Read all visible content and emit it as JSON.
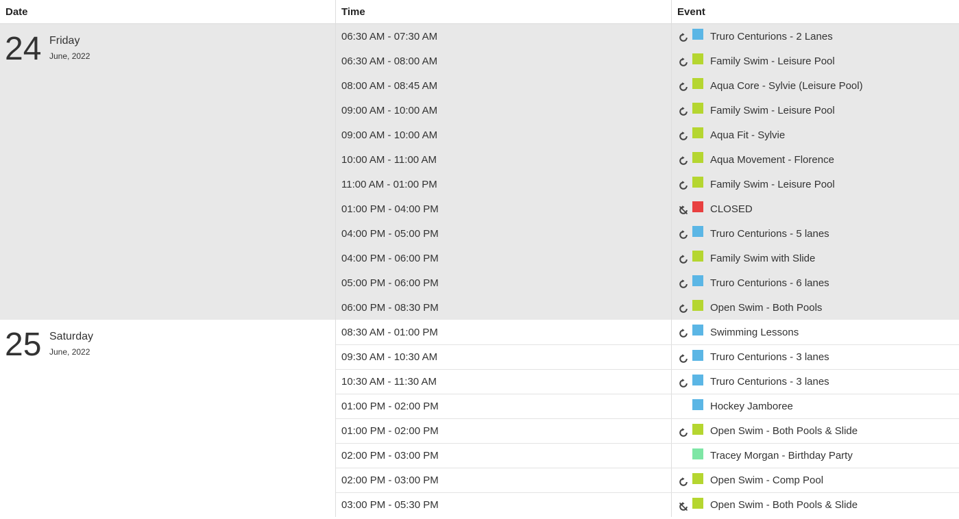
{
  "header": {
    "date": "Date",
    "time": "Time",
    "event": "Event"
  },
  "colors": {
    "blue": "#5bb6e5",
    "green": "#b5d630",
    "red": "#e84040",
    "mint": "#7ee6a5"
  },
  "days": [
    {
      "number": "24",
      "weekday": "Friday",
      "month": "June, 2022",
      "events": [
        {
          "time": "06:30 AM - 07:30 AM",
          "title": "Truro Centurions - 2 Lanes",
          "color": "#5bb6e5",
          "icon": "recurring-icon"
        },
        {
          "time": "06:30 AM - 08:00 AM",
          "title": "Family Swim - Leisure Pool",
          "color": "#b5d630",
          "icon": "recurring-icon"
        },
        {
          "time": "08:00 AM - 08:45 AM",
          "title": "Aqua Core - Sylvie (Leisure Pool)",
          "color": "#b5d630",
          "icon": "recurring-icon"
        },
        {
          "time": "09:00 AM - 10:00 AM",
          "title": "Family Swim - Leisure Pool",
          "color": "#b5d630",
          "icon": "recurring-icon"
        },
        {
          "time": "09:00 AM - 10:00 AM",
          "title": "Aqua Fit - Sylvie",
          "color": "#b5d630",
          "icon": "recurring-icon"
        },
        {
          "time": "10:00 AM - 11:00 AM",
          "title": "Aqua Movement - Florence",
          "color": "#b5d630",
          "icon": "recurring-icon"
        },
        {
          "time": "11:00 AM - 01:00 PM",
          "title": "Family Swim - Leisure Pool",
          "color": "#b5d630",
          "icon": "recurring-icon"
        },
        {
          "time": "01:00 PM - 04:00 PM",
          "title": "CLOSED",
          "color": "#e84040",
          "icon": "recurring-off-icon"
        },
        {
          "time": "04:00 PM - 05:00 PM",
          "title": "Truro Centurions - 5 lanes",
          "color": "#5bb6e5",
          "icon": "recurring-icon"
        },
        {
          "time": "04:00 PM - 06:00 PM",
          "title": "Family Swim with Slide",
          "color": "#b5d630",
          "icon": "recurring-icon"
        },
        {
          "time": "05:00 PM - 06:00 PM",
          "title": "Truro Centurions - 6 lanes",
          "color": "#5bb6e5",
          "icon": "recurring-icon"
        },
        {
          "time": "06:00 PM - 08:30 PM",
          "title": "Open Swim - Both Pools",
          "color": "#b5d630",
          "icon": "recurring-icon"
        }
      ]
    },
    {
      "number": "25",
      "weekday": "Saturday",
      "month": "June, 2022",
      "events": [
        {
          "time": "08:30 AM - 01:00 PM",
          "title": "Swimming Lessons",
          "color": "#5bb6e5",
          "icon": "recurring-icon"
        },
        {
          "time": "09:30 AM - 10:30 AM",
          "title": "Truro Centurions - 3 lanes",
          "color": "#5bb6e5",
          "icon": "recurring-icon"
        },
        {
          "time": "10:30 AM - 11:30 AM",
          "title": "Truro Centurions - 3 lanes",
          "color": "#5bb6e5",
          "icon": "recurring-icon"
        },
        {
          "time": "01:00 PM - 02:00 PM",
          "title": "Hockey Jamboree",
          "color": "#5bb6e5",
          "icon": "none"
        },
        {
          "time": "01:00 PM - 02:00 PM",
          "title": "Open Swim - Both Pools & Slide",
          "color": "#b5d630",
          "icon": "recurring-icon"
        },
        {
          "time": "02:00 PM - 03:00 PM",
          "title": "Tracey Morgan - Birthday Party",
          "color": "#7ee6a5",
          "icon": "none"
        },
        {
          "time": "02:00 PM - 03:00 PM",
          "title": "Open Swim - Comp Pool",
          "color": "#b5d630",
          "icon": "recurring-icon"
        },
        {
          "time": "03:00 PM - 05:30 PM",
          "title": "Open Swim - Both Pools & Slide",
          "color": "#b5d630",
          "icon": "recurring-off-icon"
        }
      ]
    }
  ]
}
